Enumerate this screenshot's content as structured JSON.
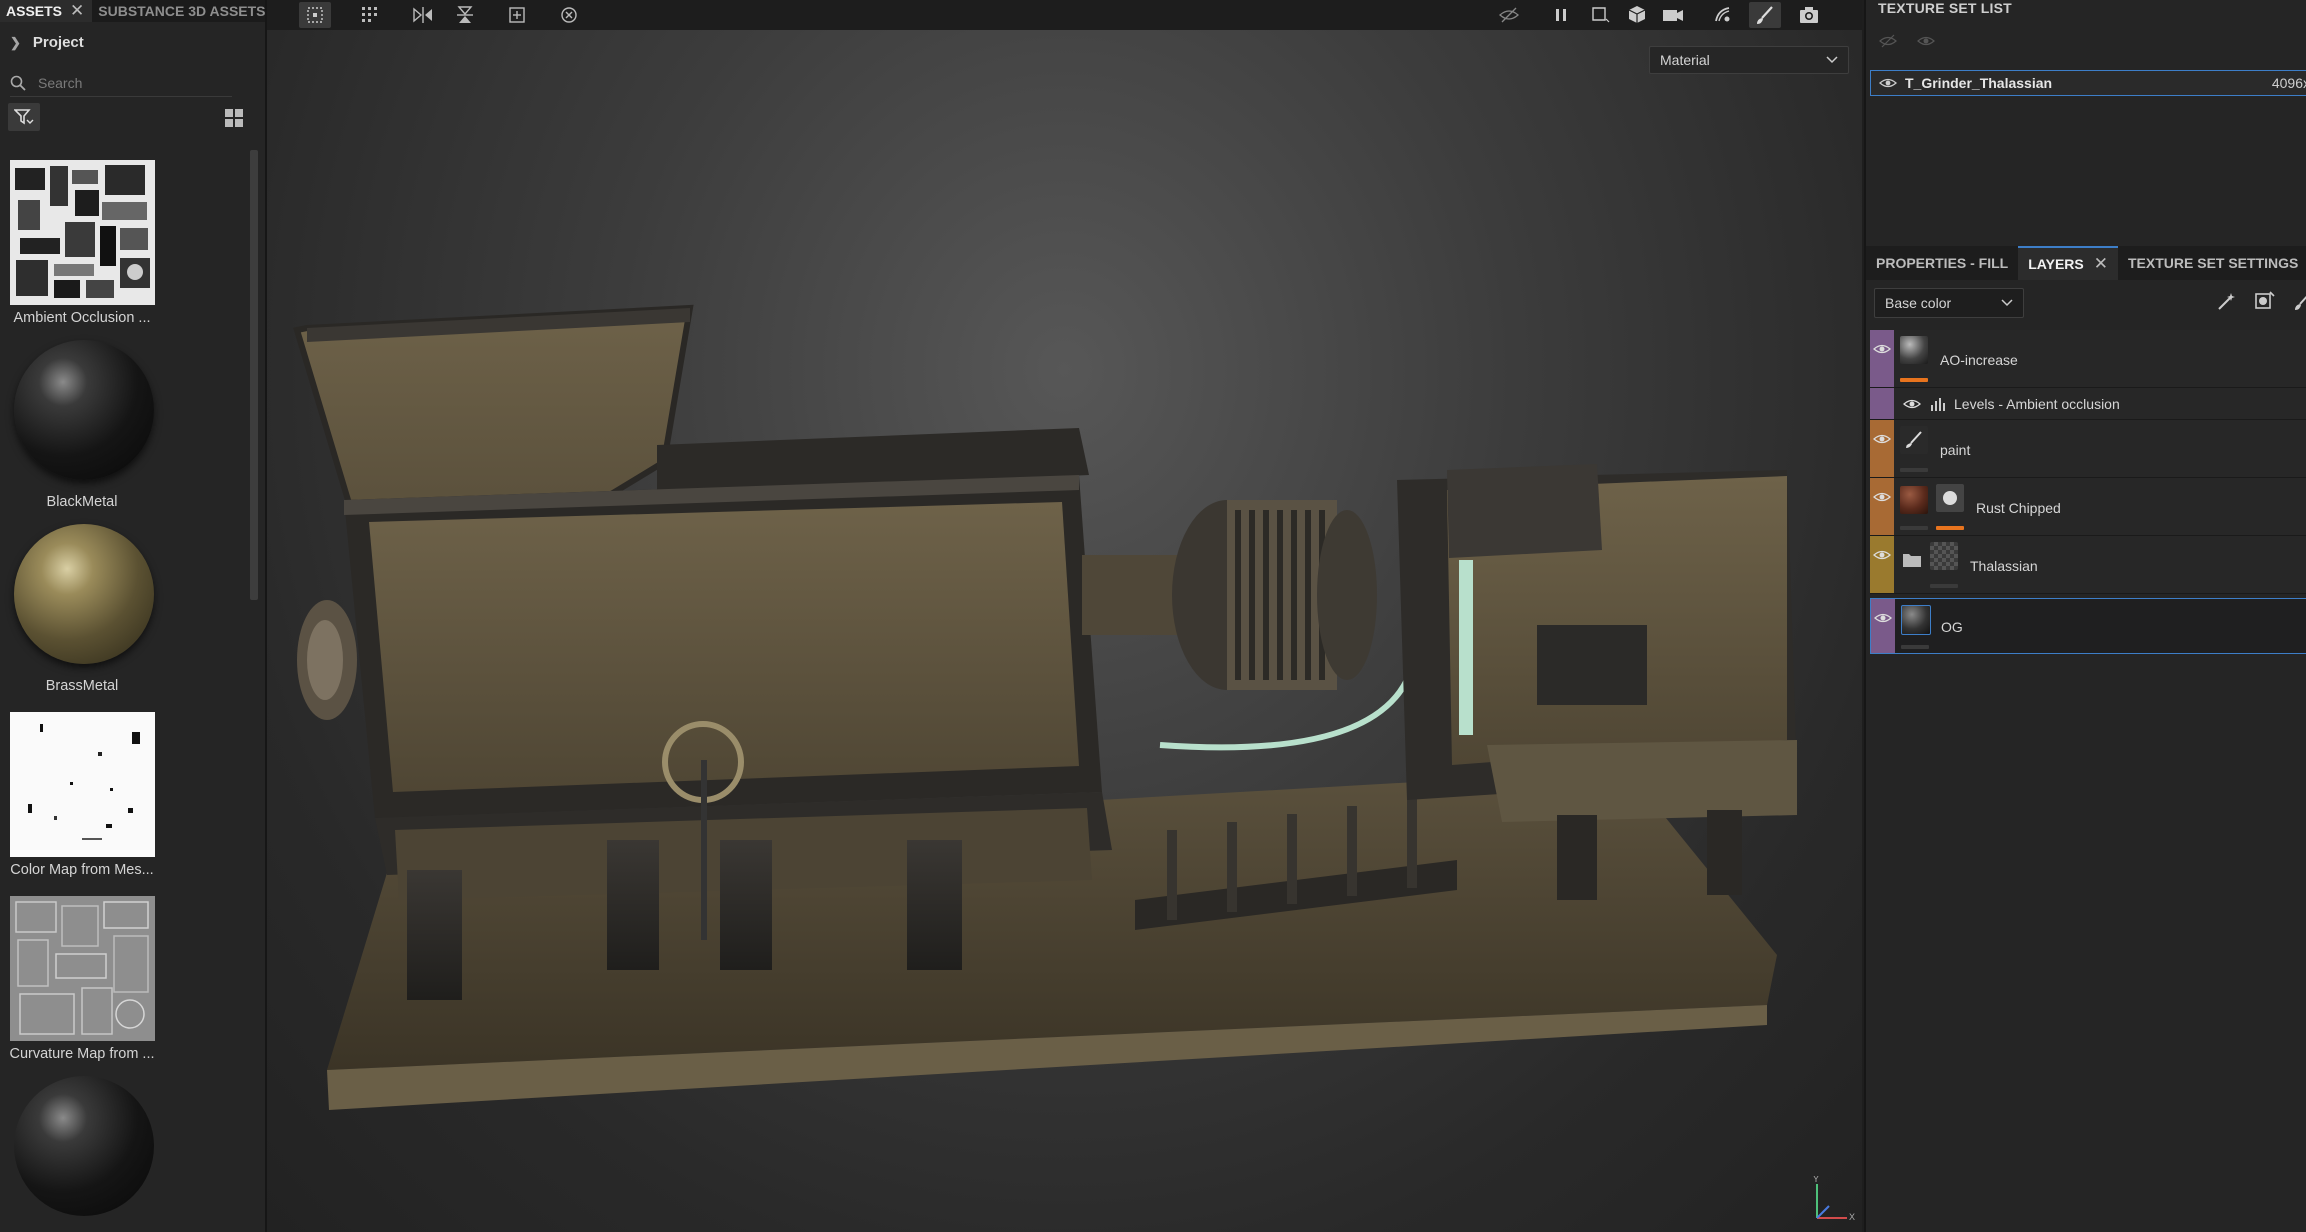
{
  "assets_panel": {
    "tabs": [
      {
        "label": "ASSETS",
        "active": true
      },
      {
        "label": "SUBSTANCE 3D ASSETS",
        "active": false
      }
    ],
    "project_label": "Project",
    "search_placeholder": "Search",
    "items": [
      {
        "label": "Ambient Occlusion ...",
        "thumb": "ao-map"
      },
      {
        "label": "BlackMetal",
        "thumb": "black-sphere"
      },
      {
        "label": "BrassMetal",
        "thumb": "brass-sphere"
      },
      {
        "label": "Color Map from Mes...",
        "thumb": "color-map"
      },
      {
        "label": "Curvature Map from ...",
        "thumb": "curvature-map"
      },
      {
        "label": "",
        "thumb": "black-sphere"
      }
    ]
  },
  "viewport": {
    "toolbar_icons": [
      "uv-select-icon",
      "grid-select-icon",
      "mirror-icon",
      "symmetry-icon",
      "add-icon",
      "history-icon",
      "hide-icon",
      "pause-icon",
      "display-icon",
      "cube-icon",
      "camera-icon",
      "lighting-icon",
      "paint-brush-icon",
      "screenshot-icon"
    ],
    "channel_select": "Material",
    "gizmo": {
      "x": "X",
      "y": "Y"
    }
  },
  "texture_set_list": {
    "title": "TEXTURE SET LIST",
    "row": {
      "name": "T_Grinder_Thalassian",
      "resolution": "4096x"
    }
  },
  "layers_panel": {
    "tabs": [
      {
        "label": "PROPERTIES - FILL"
      },
      {
        "label": "LAYERS",
        "active": true
      },
      {
        "label": "TEXTURE SET SETTINGS"
      }
    ],
    "channel_select": "Base color",
    "layers": [
      {
        "name": "AO-increase",
        "color": "#7a5a8a"
      },
      {
        "name": "Levels - Ambient occlusion",
        "color": "#7a5a8a"
      },
      {
        "name": "paint",
        "color": "#a86a34"
      },
      {
        "name": "Rust Chipped",
        "color": "#a86a34"
      },
      {
        "name": "Thalassian",
        "color": "#9a7a2e"
      },
      {
        "name": "OG",
        "color": "#7a5a8a"
      }
    ],
    "accent": "#3d7ec8",
    "opacity_bar_color": "#e8741e"
  }
}
